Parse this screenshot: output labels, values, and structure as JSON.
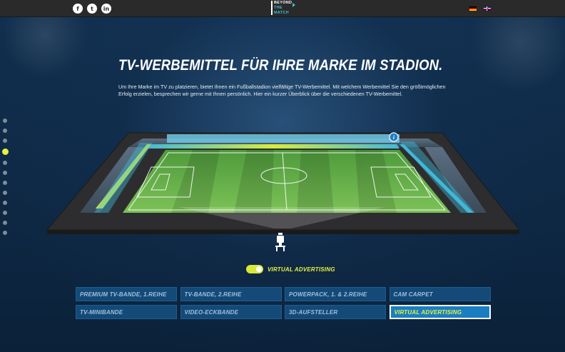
{
  "header": {
    "social": [
      {
        "name": "facebook",
        "glyph": "f"
      },
      {
        "name": "twitter",
        "glyph": "t"
      },
      {
        "name": "linkedin",
        "glyph": "in"
      }
    ],
    "logo_line1": "BEYOND",
    "logo_line2": "THE MATCH",
    "languages": [
      "de",
      "en"
    ]
  },
  "hero": {
    "title": "TV-WERBEMITTEL FÜR IHRE MARKE IM STADION.",
    "intro": "Um Ihre Marke im TV zu platzieren, bietet Ihnen ein Fußballstadion vielfältige TV-Werbemittel. Mit welchem Werbemittel Sie den größtmöglichen Erfolg erzielen, besprechen wir gerne mit Ihnen persönlich. Hier ein kurzer Überblick über die verschiedenen TV-Werbemittel."
  },
  "nav_dots": {
    "count": 12,
    "active_index": 3
  },
  "stadium": {
    "info_icon": "i"
  },
  "toggle": {
    "label": "VIRTUAL ADVERTISING",
    "on": true
  },
  "options": [
    {
      "label": "PREMIUM TV-BANDE, 1.REIHE",
      "active": false
    },
    {
      "label": "TV-BANDE, 2.REIHE",
      "active": false
    },
    {
      "label": "POWERPACK, 1. & 2.REIHE",
      "active": false
    },
    {
      "label": "CAM CARPET",
      "active": false
    },
    {
      "label": "TV-MINIBANDE",
      "active": false
    },
    {
      "label": "VIDEO-ECKBANDE",
      "active": false
    },
    {
      "label": "3D-AUFSTELLER",
      "active": false
    },
    {
      "label": "VIRTUAL ADVERTISING",
      "active": true
    }
  ],
  "colors": {
    "accent_yellow": "#e6f23e",
    "tile_blue": "#144a78",
    "tile_active": "#1b7ec2",
    "pitch_green": "#6ab34a",
    "board_cyan": "#41b9d8"
  }
}
